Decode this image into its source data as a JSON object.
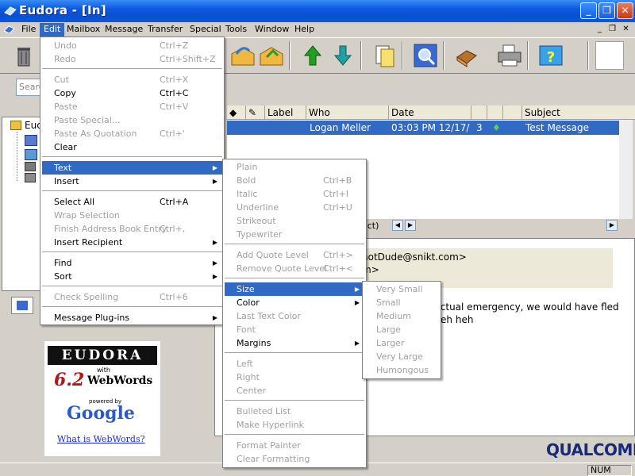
{
  "window": {
    "title": "Eudora - [In]"
  },
  "menubar": {
    "items": [
      "File",
      "Edit",
      "Mailbox",
      "Message",
      "Transfer",
      "Special",
      "Tools",
      "Window",
      "Help"
    ]
  },
  "search": {
    "placeholder": "Searc"
  },
  "tree": {
    "root_label": "Euc"
  },
  "list": {
    "columns": [
      "Label",
      "Who",
      "Date",
      "Subject"
    ],
    "row": {
      "who": "Logan Meller",
      "date": "03:03 PM 12/17/",
      "count": "3",
      "subject": "Test Message"
    },
    "hbar_text": "act)"
  },
  "preview": {
    "line1": "notDude@snikt.com>",
    "line2": "m>",
    "body1": "n actual emergency, we would have fled",
    "body2": ".. heh heh"
  },
  "ad": {
    "brand": "EUDORA",
    "with": "with",
    "version": "6.2",
    "product": "WebWords",
    "powered": "powered by",
    "google": "Google",
    "link": "What is WebWords?"
  },
  "branding": {
    "qualcomm": "QUALCOMM"
  },
  "status": {
    "num": "NUM"
  },
  "edit_menu": [
    {
      "label": "Undo",
      "shortcut": "Ctrl+Z",
      "disabled": true
    },
    {
      "label": "Redo",
      "shortcut": "Ctrl+Shift+Z",
      "disabled": true
    },
    {
      "sep": true
    },
    {
      "label": "Cut",
      "shortcut": "Ctrl+X",
      "disabled": true
    },
    {
      "label": "Copy",
      "shortcut": "Ctrl+C",
      "disabled": false
    },
    {
      "label": "Paste",
      "shortcut": "Ctrl+V",
      "disabled": true
    },
    {
      "label": "Paste Special...",
      "shortcut": "",
      "disabled": true
    },
    {
      "label": "Paste As Quotation",
      "shortcut": "Ctrl+'",
      "disabled": true
    },
    {
      "label": "Clear",
      "shortcut": "",
      "disabled": false
    },
    {
      "sep": true
    },
    {
      "label": "Text",
      "shortcut": "",
      "disabled": false,
      "submenu": true,
      "highlighted": true
    },
    {
      "label": "Insert",
      "shortcut": "",
      "disabled": false,
      "submenu": true
    },
    {
      "sep": true
    },
    {
      "label": "Select All",
      "shortcut": "Ctrl+A",
      "disabled": false
    },
    {
      "label": "Wrap Selection",
      "shortcut": "",
      "disabled": true
    },
    {
      "label": "Finish Address Book Entry",
      "shortcut": "Ctrl+,",
      "disabled": true
    },
    {
      "label": "Insert Recipient",
      "shortcut": "",
      "disabled": false,
      "submenu": true
    },
    {
      "sep": true
    },
    {
      "label": "Find",
      "shortcut": "",
      "disabled": false,
      "submenu": true
    },
    {
      "label": "Sort",
      "shortcut": "",
      "disabled": false,
      "submenu": true
    },
    {
      "sep": true
    },
    {
      "label": "Check Spelling",
      "shortcut": "Ctrl+6",
      "disabled": true
    },
    {
      "sep": true
    },
    {
      "label": "Message Plug-ins",
      "shortcut": "",
      "disabled": false,
      "submenu": true
    }
  ],
  "text_menu": [
    {
      "label": "Plain",
      "shortcut": "",
      "disabled": true
    },
    {
      "label": "Bold",
      "shortcut": "Ctrl+B",
      "disabled": true
    },
    {
      "label": "Italic",
      "shortcut": "Ctrl+I",
      "disabled": true
    },
    {
      "label": "Underline",
      "shortcut": "Ctrl+U",
      "disabled": true
    },
    {
      "label": "Strikeout",
      "shortcut": "",
      "disabled": true
    },
    {
      "label": "Typewriter",
      "shortcut": "",
      "disabled": true
    },
    {
      "sep": true
    },
    {
      "label": "Add Quote Level",
      "shortcut": "Ctrl+>",
      "disabled": true
    },
    {
      "label": "Remove Quote Level",
      "shortcut": "Ctrl+<",
      "disabled": true
    },
    {
      "sep": true
    },
    {
      "label": "Size",
      "shortcut": "",
      "disabled": false,
      "submenu": true,
      "highlighted": true
    },
    {
      "label": "Color",
      "shortcut": "",
      "disabled": false,
      "submenu": true
    },
    {
      "label": "Last Text Color",
      "shortcut": "",
      "disabled": true
    },
    {
      "label": "Font",
      "shortcut": "",
      "disabled": true
    },
    {
      "label": "Margins",
      "shortcut": "",
      "disabled": false,
      "submenu": true
    },
    {
      "sep": true
    },
    {
      "label": "Left",
      "shortcut": "",
      "disabled": true
    },
    {
      "label": "Right",
      "shortcut": "",
      "disabled": true
    },
    {
      "label": "Center",
      "shortcut": "",
      "disabled": true
    },
    {
      "sep": true
    },
    {
      "label": "Bulleted List",
      "shortcut": "",
      "disabled": true
    },
    {
      "label": "Make Hyperlink",
      "shortcut": "",
      "disabled": true
    },
    {
      "sep": true
    },
    {
      "label": "Format Painter",
      "shortcut": "",
      "disabled": true
    },
    {
      "label": "Clear Formatting",
      "shortcut": "",
      "disabled": true
    }
  ],
  "size_menu": [
    {
      "label": "Very Small",
      "disabled": true
    },
    {
      "label": "Small",
      "disabled": true
    },
    {
      "label": "Medium",
      "disabled": true
    },
    {
      "label": "Large",
      "disabled": true
    },
    {
      "label": "Larger",
      "disabled": true
    },
    {
      "label": "Very Large",
      "disabled": true
    },
    {
      "label": "Humongous",
      "disabled": true
    }
  ]
}
